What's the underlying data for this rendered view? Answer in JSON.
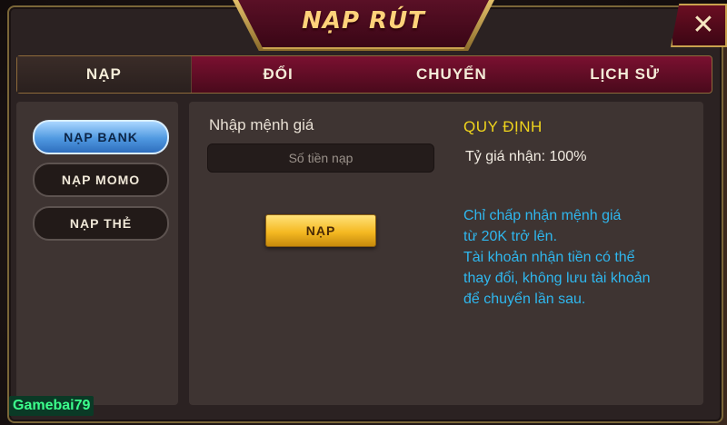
{
  "dialog": {
    "title": "NẠP RÚT",
    "close_symbol": "✕"
  },
  "tabs": [
    {
      "label": "NẠP",
      "active": true
    },
    {
      "label": "ĐỔI",
      "active": false
    },
    {
      "label": "CHUYỂN",
      "active": false
    },
    {
      "label": "LỊCH SỬ",
      "active": false
    }
  ],
  "methods": [
    {
      "label": "NẠP BANK",
      "active": true
    },
    {
      "label": "NẠP MOMO",
      "active": false
    },
    {
      "label": "NẠP THẺ",
      "active": false
    }
  ],
  "deposit": {
    "amount_label": "Nhập mệnh giá",
    "amount_placeholder": "Số tiền nạp",
    "amount_value": "",
    "submit_label": "NẠP"
  },
  "rules": {
    "title": "QUY ĐỊNH",
    "rate": "Tỷ giá nhận: 100%",
    "note_lines": [
      "Chỉ chấp nhận mệnh giá",
      "từ 20K trở lên.",
      "Tài khoản nhận tiền có thể",
      "thay đổi, không lưu tài khoản",
      "để chuyển lần sau."
    ]
  },
  "watermark": "Gamebai79",
  "colors": {
    "accent_gold": "#f5b922",
    "tab_bar": "#7a1030",
    "active_method": "#4f98e0",
    "rules_title": "#f0d51c",
    "note_text": "#2fb7ee",
    "watermark": "#3cff8c"
  }
}
